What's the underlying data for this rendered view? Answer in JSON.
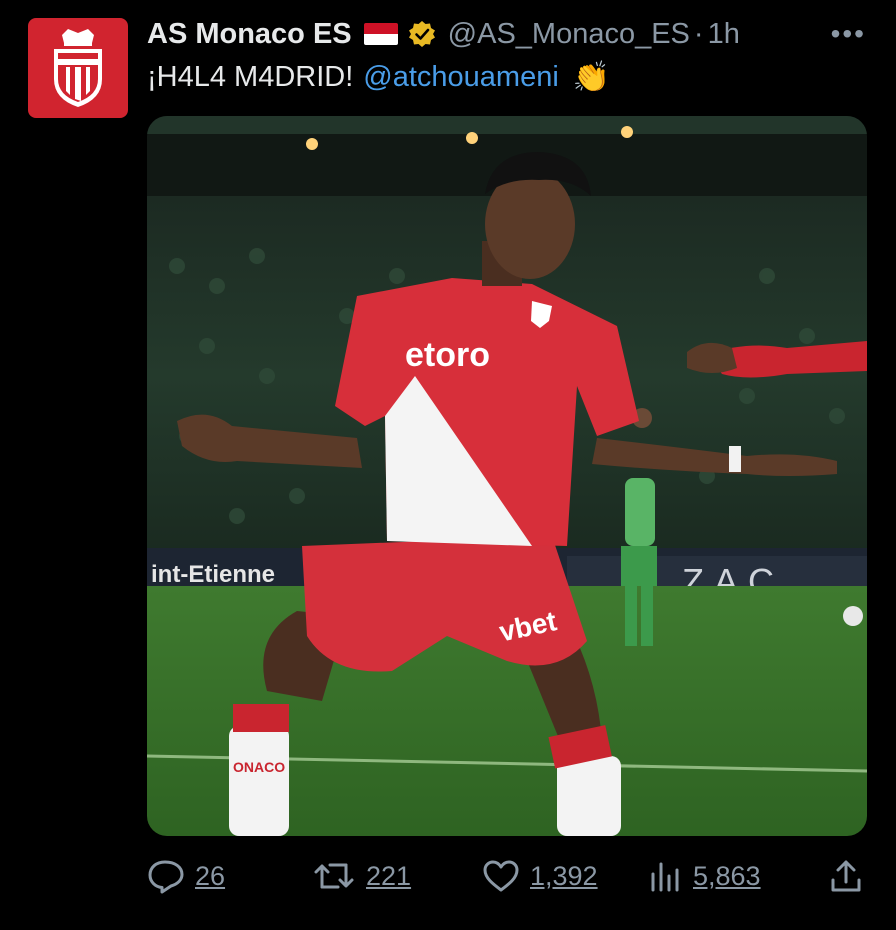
{
  "account": {
    "name": "AS Monaco ES",
    "handle": "@AS_Monaco_ES",
    "separator": "·",
    "time": "1h",
    "more_icon": "more-horizontal-icon",
    "flag_colors": [
      "#ce1126",
      "#ffffff"
    ],
    "verified_color": "#e8b923",
    "avatar_color": "#d1242f"
  },
  "tweet": {
    "text": "¡H4L4 M4DRID!",
    "mention": "@atchouameni",
    "emoji": "👏"
  },
  "media": {
    "sponsor_front": "etoro",
    "sponsor_shorts": "vbet",
    "board_left": "int-Etienne",
    "board_right": "ZAC",
    "sock_text": "ONACO"
  },
  "actions": {
    "replies": "26",
    "retweets": "221",
    "likes": "1,392",
    "views": "5,863"
  },
  "colors": {
    "link": "#4a9de8",
    "muted": "#8b98a5",
    "text": "#e7e9ea"
  }
}
